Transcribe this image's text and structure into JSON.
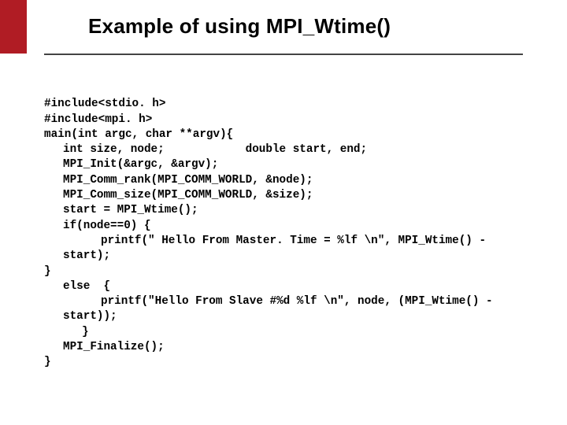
{
  "slide": {
    "title": "Example of using MPI_Wtime()"
  },
  "code": {
    "l0": "#include<stdio. h>",
    "l1": "#include<mpi. h>",
    "l2": "main(int argc, char **argv){",
    "l3": "int size, node;            double start, end;",
    "l4": "MPI_Init(&argc, &argv);",
    "l5": "MPI_Comm_rank(MPI_COMM_WORLD, &node);",
    "l6": "MPI_Comm_size(MPI_COMM_WORLD, &size);",
    "l7": "start = MPI_Wtime();",
    "l8": "if(node==0) {",
    "l9": "printf(\" Hello From Master. Time = %lf \\n\", MPI_Wtime() -",
    "l10": "start);",
    "l11": "}",
    "l12": "else  {",
    "l13": "printf(\"Hello From Slave #%d %lf \\n\", node, (MPI_Wtime() -",
    "l14": "start));",
    "l15": "}",
    "l16": "MPI_Finalize();",
    "l17": "}"
  }
}
